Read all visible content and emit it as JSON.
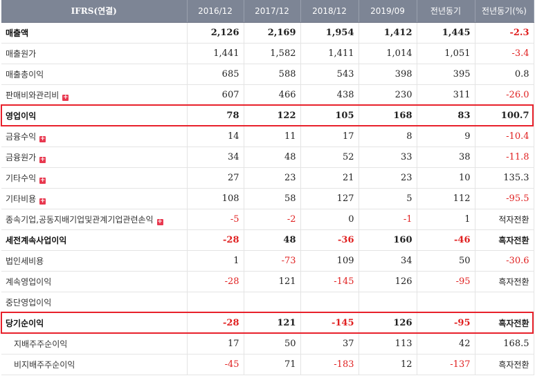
{
  "header": [
    "IFRS(연결)",
    "2016/12",
    "2017/12",
    "2018/12",
    "2019/09",
    "전년동기",
    "전년동기(%)"
  ],
  "rows": [
    {
      "label": "매출액",
      "values": [
        "2,126",
        "2,169",
        "1,954",
        "1,412",
        "1,445",
        "-2.3"
      ],
      "bold": true,
      "plus": false
    },
    {
      "label": "매출원가",
      "values": [
        "1,441",
        "1,582",
        "1,411",
        "1,014",
        "1,051",
        "-3.4"
      ],
      "bold": false,
      "plus": false
    },
    {
      "label": "매출총이익",
      "values": [
        "685",
        "588",
        "543",
        "398",
        "395",
        "0.8"
      ],
      "bold": false,
      "plus": false
    },
    {
      "label": "판매비와관리비",
      "values": [
        "607",
        "466",
        "438",
        "230",
        "311",
        "-26.0"
      ],
      "bold": false,
      "plus": true
    },
    {
      "label": "영업이익",
      "values": [
        "78",
        "122",
        "105",
        "168",
        "83",
        "100.7"
      ],
      "bold": true,
      "plus": false
    },
    {
      "label": "금융수익",
      "values": [
        "14",
        "11",
        "17",
        "8",
        "9",
        "-10.4"
      ],
      "bold": false,
      "plus": true
    },
    {
      "label": "금융원가",
      "values": [
        "34",
        "48",
        "52",
        "33",
        "38",
        "-11.8"
      ],
      "bold": false,
      "plus": true
    },
    {
      "label": "기타수익",
      "values": [
        "27",
        "23",
        "21",
        "23",
        "10",
        "135.3"
      ],
      "bold": false,
      "plus": true
    },
    {
      "label": "기타비용",
      "values": [
        "108",
        "58",
        "127",
        "5",
        "112",
        "-95.5"
      ],
      "bold": false,
      "plus": true
    },
    {
      "label": "종속기업,공동지배기업및관계기업관련손익",
      "values": [
        "-5",
        "-2",
        "0",
        "-1",
        "1",
        "적자전환"
      ],
      "bold": false,
      "plus": true
    },
    {
      "label": "세전계속사업이익",
      "values": [
        "-28",
        "48",
        "-36",
        "160",
        "-46",
        "흑자전환"
      ],
      "bold": true,
      "plus": false
    },
    {
      "label": "법인세비용",
      "values": [
        "1",
        "-73",
        "109",
        "34",
        "50",
        "-30.6"
      ],
      "bold": false,
      "plus": false
    },
    {
      "label": "계속영업이익",
      "values": [
        "-28",
        "121",
        "-145",
        "126",
        "-95",
        "흑자전환"
      ],
      "bold": false,
      "plus": false
    },
    {
      "label": "중단영업이익",
      "values": [
        "",
        "",
        "",
        "",
        "",
        ""
      ],
      "bold": false,
      "plus": false
    },
    {
      "label": "당기순이익",
      "values": [
        "-28",
        "121",
        "-145",
        "126",
        "-95",
        "흑자전환"
      ],
      "bold": true,
      "plus": false
    },
    {
      "label": "지배주주순이익",
      "values": [
        "17",
        "50",
        "37",
        "113",
        "42",
        "168.5"
      ],
      "bold": false,
      "plus": false,
      "sub": true
    },
    {
      "label": "비지배주주순이익",
      "values": [
        "-45",
        "71",
        "-183",
        "12",
        "-137",
        "흑자전환"
      ],
      "bold": false,
      "plus": false,
      "sub": true
    }
  ],
  "highlight_rows": [
    4,
    14
  ],
  "colors": {
    "header_bg": "#7d8595",
    "negative": "#e02020",
    "highlight_border": "#e8202a",
    "plus_icon": "#e8384f"
  },
  "icons": {
    "expand": "plus-square-icon"
  },
  "plus_glyph": "+"
}
